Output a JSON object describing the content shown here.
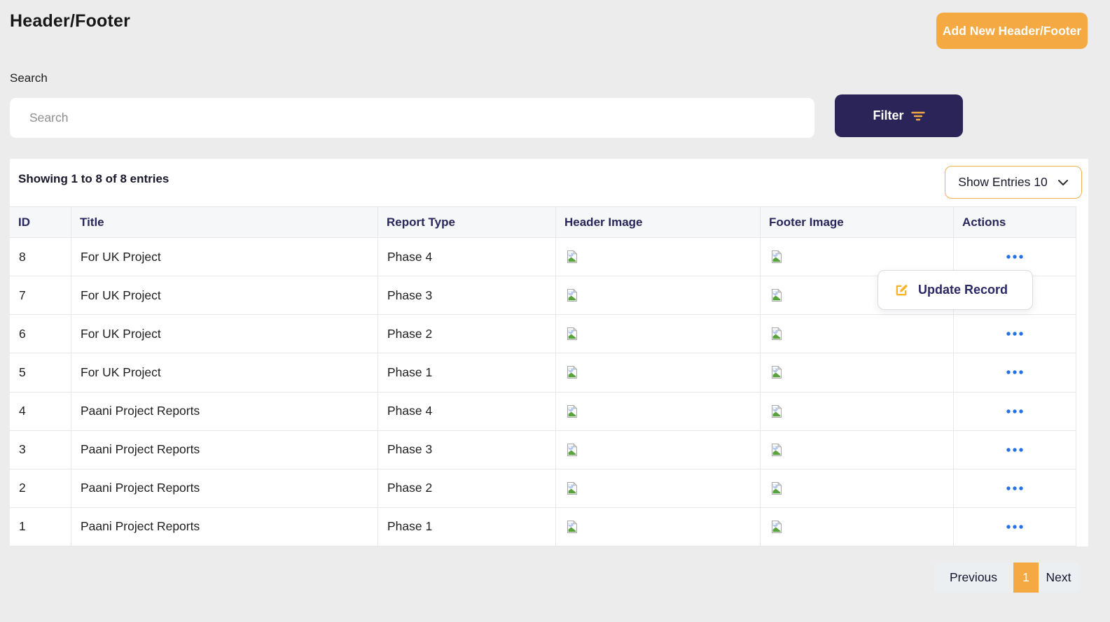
{
  "page": {
    "title": "Header/Footer"
  },
  "toolbar": {
    "add_button_label": "Add New Header/Footer"
  },
  "search": {
    "label": "Search",
    "placeholder": "Search"
  },
  "filter": {
    "button_label": "Filter"
  },
  "table_panel": {
    "showing_text": "Showing 1 to 8 of 8 entries",
    "show_entries_label": "Show Entries 10",
    "columns": [
      "ID",
      "Title",
      "Report Type",
      "Header Image",
      "Footer Image",
      "Actions"
    ],
    "rows": [
      {
        "id": "8",
        "title": "For UK Project",
        "report_type": "Phase 4"
      },
      {
        "id": "7",
        "title": "For UK Project",
        "report_type": "Phase 3"
      },
      {
        "id": "6",
        "title": "For UK Project",
        "report_type": "Phase 2"
      },
      {
        "id": "5",
        "title": "For UK Project",
        "report_type": "Phase 1"
      },
      {
        "id": "4",
        "title": "Paani Project Reports",
        "report_type": "Phase 4"
      },
      {
        "id": "3",
        "title": "Paani Project Reports",
        "report_type": "Phase 3"
      },
      {
        "id": "2",
        "title": "Paani Project Reports",
        "report_type": "Phase 2"
      },
      {
        "id": "1",
        "title": "Paani Project Reports",
        "report_type": "Phase 1"
      }
    ]
  },
  "action_menu": {
    "update_label": "Update Record"
  },
  "pagination": {
    "previous_label": "Previous",
    "current_page": "1",
    "next_label": "Next"
  },
  "icons": {
    "filter": "filter-lines-icon",
    "entries_chevron": "chevron-down-icon",
    "row_image": "broken-image-icon",
    "row_actions": "ellipsis-icon",
    "update": "edit-icon"
  },
  "colors": {
    "accent_orange": "#F5A942",
    "filter_navy": "#2A2458",
    "heading_navy": "#2B2866",
    "action_blue": "#2471E8",
    "page_background": "#ECECEC"
  }
}
